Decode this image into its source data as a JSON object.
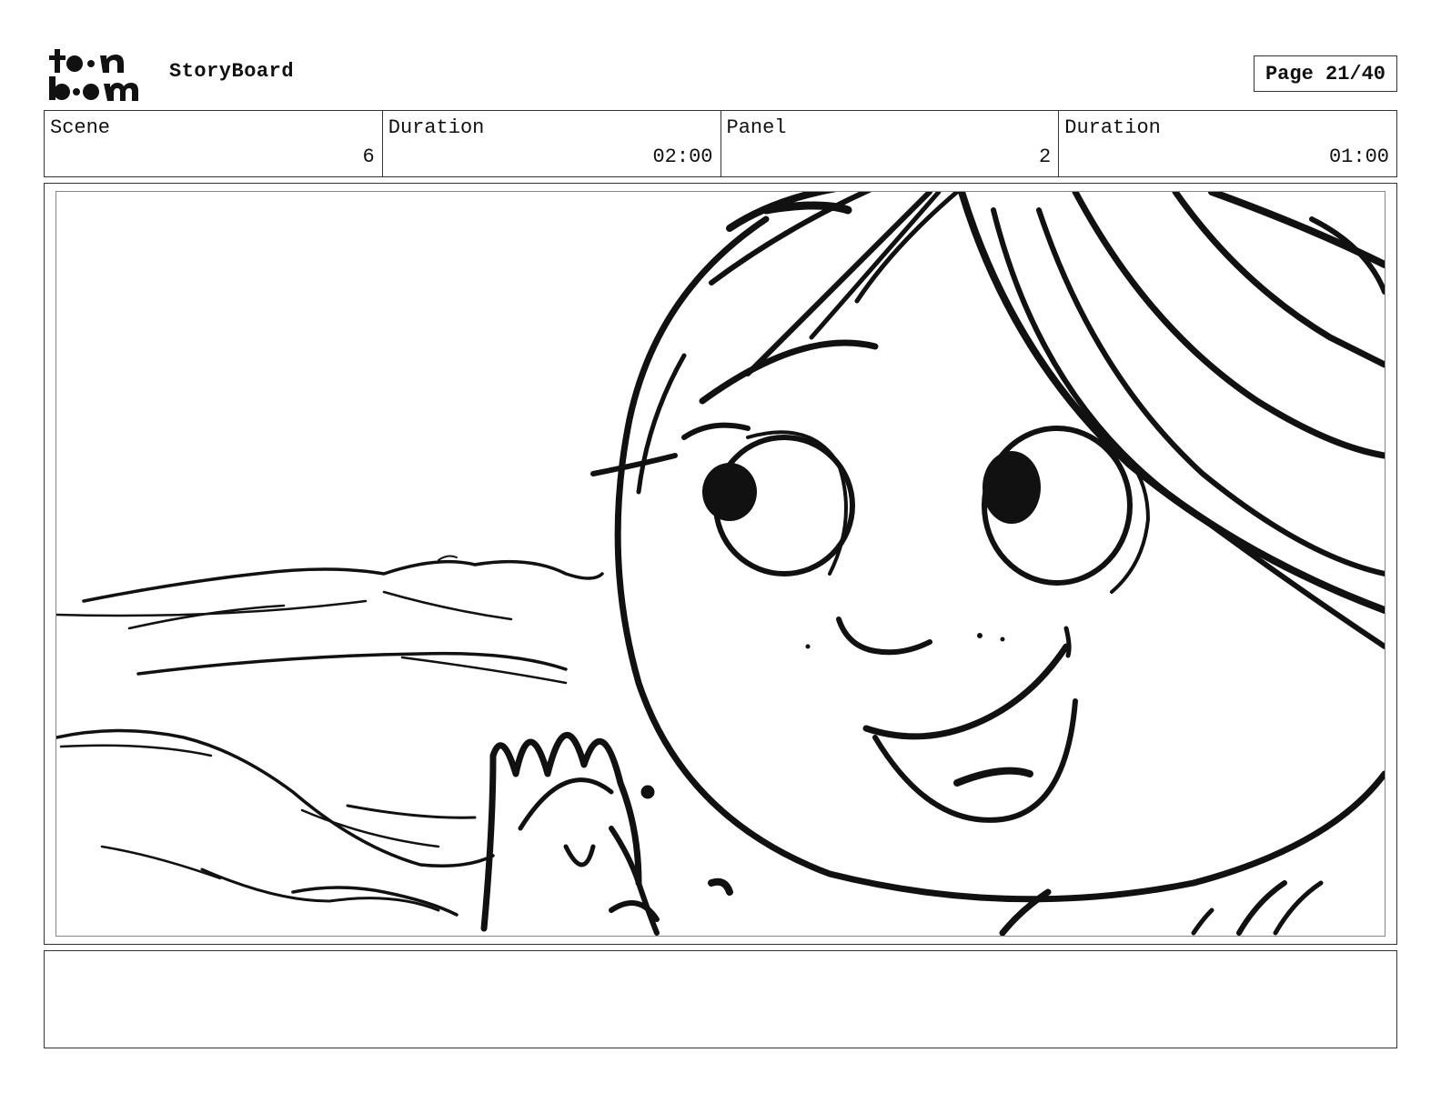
{
  "header": {
    "logo_text": "toon boom",
    "app_title": "StoryBoard",
    "page_label": "Page 21/40"
  },
  "info": {
    "scene_label": "Scene",
    "scene_value": "6",
    "scene_duration_label": "Duration",
    "scene_duration_value": "02:00",
    "panel_label": "Panel",
    "panel_value": "2",
    "panel_duration_label": "Duration",
    "panel_duration_value": "01:00"
  },
  "panel": {
    "image_icon": "sketch-girl-face-icon"
  },
  "notes": {
    "text": ""
  },
  "colors": {
    "ink": "#111111",
    "border": "#333333"
  }
}
